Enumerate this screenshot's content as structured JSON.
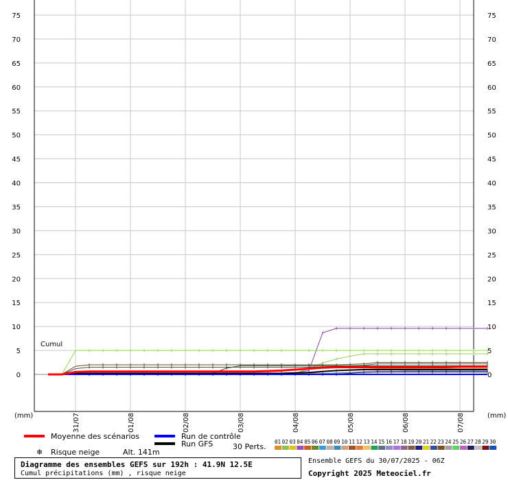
{
  "chart_data": {
    "type": "line",
    "ylim": [
      0,
      75
    ],
    "yticks": [
      0,
      5,
      10,
      15,
      20,
      25,
      30,
      35,
      40,
      45,
      50,
      55,
      60,
      65,
      70,
      75
    ],
    "unit_left": "(mm)",
    "unit_right": "(mm)",
    "date_labels": [
      "31/07",
      "01/08",
      "02/08",
      "03/08",
      "04/08",
      "05/08",
      "06/08",
      "07/08"
    ],
    "x_steps": [
      0,
      1,
      2,
      3,
      4,
      5,
      6,
      7,
      8,
      9,
      10,
      11,
      12,
      13,
      14,
      15,
      16,
      17,
      18,
      19,
      20,
      21,
      22,
      23,
      24,
      25,
      26,
      27,
      28,
      29,
      30,
      31,
      32
    ],
    "annotation": "Cumul",
    "series": [
      {
        "role": "member",
        "color": "#8b3da8",
        "values": [
          0,
          0,
          0,
          0.3,
          0.3,
          0.3,
          0.3,
          0.3,
          0.3,
          0.3,
          0.3,
          0.3,
          0.3,
          0.3,
          0.3,
          0.3,
          0.3,
          0.3,
          0.4,
          0.8,
          8.7,
          9.6,
          9.6,
          9.6,
          9.6,
          9.6,
          9.6,
          9.6,
          9.6,
          9.6,
          9.6,
          9.6,
          9.6
        ]
      },
      {
        "role": "member",
        "color": "#90e040",
        "values": [
          0,
          0,
          5,
          5,
          5,
          5,
          5,
          5,
          5,
          5,
          5,
          5,
          5,
          5,
          5,
          5,
          5,
          5,
          5,
          5,
          5,
          5,
          5,
          5,
          5,
          5,
          5,
          5,
          5,
          5,
          5,
          5,
          5
        ]
      },
      {
        "role": "member",
        "color": "#9acd5a",
        "values": [
          0,
          0,
          0.1,
          0.1,
          0.1,
          0.1,
          0.1,
          0.1,
          0.1,
          0.1,
          0.1,
          0.1,
          0.1,
          0.1,
          0.1,
          0.1,
          0.1,
          0.1,
          0.3,
          1.2,
          2.4,
          3.2,
          3.8,
          4.3,
          4.3,
          4.3,
          4.3,
          4.3,
          4.3,
          4.3,
          4.3,
          4.3,
          4.3
        ]
      },
      {
        "role": "member",
        "color": "#6b4a1a",
        "values": [
          0,
          0,
          1.7,
          2,
          2,
          2,
          2,
          2,
          2,
          2,
          2,
          2,
          2,
          2,
          2,
          2,
          2,
          2,
          2,
          2,
          2,
          2,
          2.1,
          2.2,
          2.5,
          2.5,
          2.5,
          2.5,
          2.5,
          2.5,
          2.5,
          2.5,
          2.5
        ]
      },
      {
        "role": "member",
        "color": "#505050",
        "values": [
          0,
          0,
          1.2,
          1.5,
          1.5,
          1.5,
          1.5,
          1.5,
          1.5,
          1.5,
          1.5,
          1.5,
          1.5,
          1.5,
          1.5,
          1.5,
          1.5,
          1.5,
          1.5,
          1.5,
          1.6,
          1.7,
          1.8,
          1.9,
          2.2,
          2.2,
          2.2,
          2.2,
          2.2,
          2.2,
          2.2,
          2.2,
          2.2
        ]
      },
      {
        "role": "member",
        "color": "#2a4a2a",
        "values": [
          0,
          0,
          0.2,
          0.2,
          0.2,
          0.2,
          0.2,
          0.2,
          0.2,
          0.2,
          0.2,
          0.2,
          0.2,
          1.3,
          1.8,
          1.8,
          1.8,
          1.8,
          1.8,
          1.8,
          1.8,
          1.8,
          1.8,
          1.8,
          1.8,
          1.8,
          1.8,
          1.8,
          1.8,
          1.8,
          1.8,
          1.8,
          1.8
        ]
      },
      {
        "role": "member",
        "color": "#d08030",
        "values": [
          0,
          0,
          0.1,
          0.1,
          0.1,
          0.1,
          0.1,
          0.1,
          0.1,
          0.1,
          0.1,
          0.1,
          0.1,
          0.1,
          0.1,
          0.1,
          0.1,
          0.1,
          0.1,
          0.2,
          0.5,
          0.8,
          1,
          1.1,
          1.2,
          1.2,
          1.2,
          1.2,
          1.2,
          1.2,
          1.2,
          1.2,
          1.2
        ]
      },
      {
        "role": "member",
        "color": "#3070c0",
        "values": [
          0,
          0,
          0.1,
          0.1,
          0.1,
          0.1,
          0.1,
          0.1,
          0.1,
          0.1,
          0.1,
          0.1,
          0.1,
          0.1,
          0.1,
          0.1,
          0.1,
          0.1,
          0.1,
          0.1,
          0.2,
          0.3,
          0.4,
          0.5,
          0.6,
          0.6,
          0.7,
          0.7,
          0.7,
          0.7,
          0.7,
          0.7,
          0.7
        ]
      },
      {
        "role": "member",
        "color": "#8a8a8a",
        "values": [
          0,
          0,
          0,
          0,
          0,
          0,
          0,
          0,
          0,
          0,
          0,
          0,
          0,
          0,
          0,
          0,
          0,
          0,
          0,
          0.1,
          0.1,
          0.2,
          0.3,
          0.3,
          0.4,
          0.4,
          0.4,
          0.4,
          0.4,
          0.4,
          0.4,
          0.4,
          0.4
        ]
      },
      {
        "role": "member",
        "color": "#1a1a6a",
        "values": [
          0,
          0,
          0,
          0,
          0,
          0,
          0,
          0,
          0,
          0,
          0,
          0,
          0,
          0,
          0,
          0,
          0,
          0,
          0,
          0,
          0,
          0,
          0.2,
          0.5,
          0.6,
          0.6,
          0.6,
          0.6,
          0.6,
          0.6,
          0.6,
          0.6,
          0.6
        ]
      },
      {
        "role": "run_gfs",
        "color": "#000000",
        "values": [
          0,
          0,
          0.2,
          0.2,
          0.2,
          0.2,
          0.2,
          0.2,
          0.2,
          0.2,
          0.2,
          0.2,
          0.2,
          0.2,
          0.2,
          0.2,
          0.2,
          0.2,
          0.3,
          0.4,
          0.6,
          0.8,
          0.9,
          1,
          1,
          1,
          1,
          1,
          1,
          1,
          1,
          1,
          1
        ]
      },
      {
        "role": "control",
        "color": "#0000ff",
        "values": [
          0,
          0,
          0,
          0,
          0,
          0,
          0,
          0,
          0,
          0,
          0,
          0,
          0,
          0,
          0,
          0,
          0,
          0,
          0,
          0,
          0,
          0,
          0,
          0,
          0,
          0,
          0,
          0,
          0,
          0,
          0,
          0,
          0
        ]
      },
      {
        "role": "mean",
        "color": "#ff0000",
        "values": [
          0,
          0,
          0.5,
          0.6,
          0.6,
          0.6,
          0.6,
          0.6,
          0.6,
          0.6,
          0.6,
          0.6,
          0.6,
          0.6,
          0.6,
          0.6,
          0.7,
          0.8,
          1.0,
          1.2,
          1.4,
          1.5,
          1.5,
          1.5,
          1.5,
          1.5,
          1.5,
          1.5,
          1.5,
          1.5,
          1.6,
          1.6,
          1.6
        ]
      }
    ]
  },
  "legend": {
    "mean_label": "Moyenne des scénarios",
    "control_label": "Run de contrôle",
    "gfs_label": "Run GFS",
    "snow_label": "Risque neige",
    "alt_label": "Alt. 141m",
    "perts_label": "30 Perts.",
    "colors": {
      "mean": "#ff0000",
      "control": "#0000ff",
      "gfs": "#000000",
      "snow_icon": "#3aa0d8"
    },
    "pert_numbers": [
      "01",
      "02",
      "03",
      "04",
      "05",
      "06",
      "07",
      "08",
      "09",
      "10",
      "11",
      "12",
      "13",
      "14",
      "15",
      "16",
      "17",
      "18",
      "19",
      "20",
      "21",
      "22",
      "23",
      "24",
      "25",
      "26",
      "27",
      "28",
      "29",
      "30"
    ],
    "pert_colors": [
      "#e08c2a",
      "#90c050",
      "#e0c020",
      "#9a50b0",
      "#d05a1a",
      "#6a8a20",
      "#3a9ae0",
      "#c0b0a0",
      "#3a8ac0",
      "#d0a080",
      "#a0522d",
      "#e87a3a",
      "#f0c060",
      "#20a060",
      "#607080",
      "#9090c0",
      "#b070e0",
      "#906090",
      "#806040",
      "#202080",
      "#e0d020",
      "#3050a0",
      "#805020",
      "#a0a0a0",
      "#60d060",
      "#c060c0",
      "#202060",
      "#c0c0c0",
      "#801010",
      "#1050c0"
    ]
  },
  "info": {
    "title": "Diagramme des ensembles GEFS sur 192h : 41.9N 12.5E",
    "subtitle": "Cumul précipitations (mm) , risque neige",
    "run": "Ensemble GEFS du 30/07/2025 - 06Z",
    "copyright": "Copyright 2025 Meteociel.fr"
  }
}
